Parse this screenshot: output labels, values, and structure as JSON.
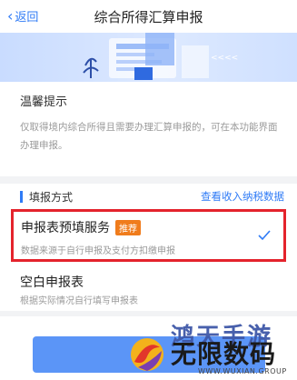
{
  "nav": {
    "back_label": "返回",
    "title": "综合所得汇算申报"
  },
  "banner": {
    "arrows_text": "<<<<"
  },
  "tips": {
    "title": "温馨提示",
    "text": "仅取得境内综合所得且需要办理汇算申报的，可在本功能界面办理申报。"
  },
  "section": {
    "title": "填报方式",
    "link": "查看收入纳税数据",
    "options": [
      {
        "title": "申报表预填服务",
        "tag": "推荐",
        "desc": "数据来源于自行申报及支付方扣缴申报",
        "selected": true
      },
      {
        "title": "空白申报表",
        "desc": "根据实际情况自行填写申报表",
        "selected": false
      }
    ]
  },
  "watermark": {
    "top": "鸿天手游",
    "name": "无限数码",
    "url": "WWW.WUXIAN.GROUP"
  },
  "colors": {
    "accent": "#2f7bf6",
    "highlight_border": "#e4232c",
    "tag": "#f07c1c"
  }
}
